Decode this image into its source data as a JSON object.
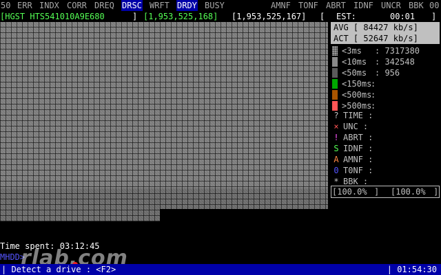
{
  "status_flags": [
    {
      "label": "50",
      "on": false
    },
    {
      "label": "ERR",
      "on": false
    },
    {
      "label": "INDX",
      "on": false
    },
    {
      "label": "CORR",
      "on": false
    },
    {
      "label": "DREQ",
      "on": false
    },
    {
      "label": "DRSC",
      "on": true
    },
    {
      "label": "WRFT",
      "on": false
    },
    {
      "label": "DRDY",
      "on": true
    },
    {
      "label": "BUSY",
      "on": false
    },
    {
      "label": "AMNF",
      "on": false
    },
    {
      "label": "TONF",
      "on": false
    },
    {
      "label": "ABRT",
      "on": false
    },
    {
      "label": "IDNF",
      "on": false
    },
    {
      "label": "UNCR",
      "on": false
    },
    {
      "label": "BBK",
      "on": false
    },
    {
      "label": "00",
      "on": false
    }
  ],
  "drive": {
    "model": "[HGST HTS541010A9E680",
    "sep1": "]",
    "current_lba": "[1,953,525,168]",
    "total_lba": "[1,953,525,167]",
    "bracket_open": "[",
    "est_label": "EST:",
    "est_value": "00:01",
    "bracket_close": "]"
  },
  "speed": {
    "avg_label": "AVG",
    "avg_value": "[ 84427 kb/s]",
    "act_label": "ACT",
    "act_value": "[ 52647 kb/s]"
  },
  "legend": [
    {
      "label": "<3ms",
      "value": ": 7317380",
      "color": "#c0c0c0"
    },
    {
      "label": "<10ms",
      "value": ": 342548",
      "color": "#8a8a8a"
    },
    {
      "label": "<50ms",
      "value": ": 956",
      "color": "#5a5a5a"
    },
    {
      "label": "<150ms",
      "value": ":",
      "color": "#00a800"
    },
    {
      "label": "<500ms",
      "value": ":",
      "color": "#a85400"
    },
    {
      "label": ">500ms",
      "value": ":",
      "color": "#ff5555"
    }
  ],
  "errors": [
    {
      "icon": "?",
      "label": "TIME :",
      "color": "#c0c0c0"
    },
    {
      "icon": "×",
      "label": "UNC  :",
      "color": "#ff5555"
    },
    {
      "icon": "!",
      "label": "ABRT :",
      "color": "#ff55ff"
    },
    {
      "icon": "S",
      "label": "IDNF :",
      "color": "#55ff55"
    },
    {
      "icon": "A",
      "label": "AMNF :",
      "color": "#ff8844"
    },
    {
      "icon": "0",
      "label": "T0NF :",
      "color": "#5555ff"
    },
    {
      "icon": "*",
      "label": "BBK  :",
      "color": "#c0c0c0"
    }
  ],
  "progress": {
    "left": "[100.0%",
    "mid": "]",
    "right": "[100.0%",
    "end": "]"
  },
  "time_spent": {
    "label": "Time spent:",
    "value": "03:12:45"
  },
  "mode_text": "MHDD>",
  "watermark": "rlab.com",
  "bottom_bar": {
    "left": "| Detect a drive : <F2>",
    "right": "| 01:54:30"
  }
}
